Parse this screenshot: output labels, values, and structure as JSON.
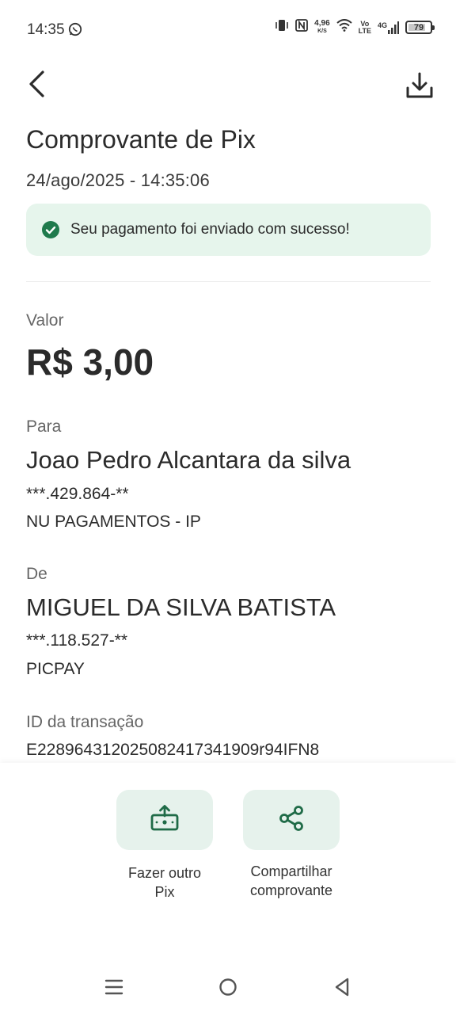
{
  "status_bar": {
    "time": "14:35",
    "net_speed_value": "4,96",
    "net_speed_unit": "K/S",
    "volte_line1": "Vo",
    "volte_line2": "LTE",
    "network_type": "4G",
    "battery": "79",
    "battery_level_percent": 79
  },
  "header": {
    "title": "Comprovante de Pix",
    "datetime": "24/ago/2025 - 14:35:06"
  },
  "success": {
    "message": "Seu pagamento foi enviado com sucesso!"
  },
  "value": {
    "label": "Valor",
    "amount": "R$ 3,00"
  },
  "to": {
    "label": "Para",
    "name": "Joao Pedro Alcantara da silva",
    "document": "***.429.864-**",
    "institution": "NU PAGAMENTOS - IP"
  },
  "from": {
    "label": "De",
    "name": "MIGUEL DA SILVA BATISTA",
    "document": "***.118.527-**",
    "institution": "PICPAY"
  },
  "transaction": {
    "label": "ID da transação",
    "id": "E22896431202508241734190 9r94IFN8"
  },
  "actions": {
    "new_pix_line1": "Fazer outro",
    "new_pix_line2": "Pix",
    "share_line1": "Compartilhar",
    "share_line2": "comprovante"
  },
  "colors": {
    "accent": "#1f7a4c",
    "banner_bg": "#e6f5ec",
    "action_bg": "#e6f2ec"
  }
}
